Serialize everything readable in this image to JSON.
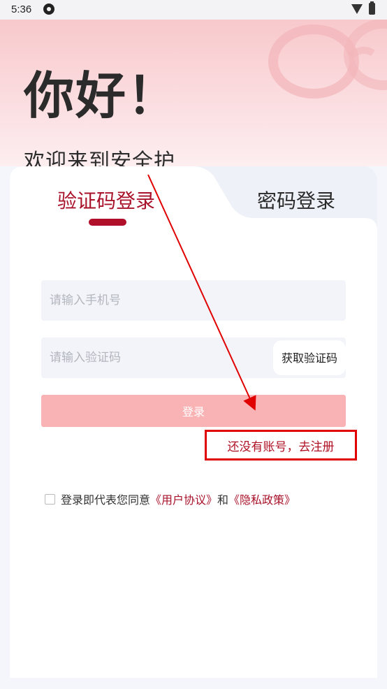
{
  "status_bar": {
    "time": "5:36",
    "icons": [
      "app-notification-icon",
      "wifi-icon",
      "battery-icon"
    ]
  },
  "hero": {
    "title": "你好！",
    "subtitle": "欢迎来到安全护"
  },
  "tabs": [
    {
      "label": "验证码登录",
      "active": true
    },
    {
      "label": "密码登录",
      "active": false
    }
  ],
  "form": {
    "phone_placeholder": "请输入手机号",
    "code_placeholder": "请输入验证码",
    "get_code_label": "获取验证码",
    "login_label": "登录",
    "register_label": "还没有账号，去注册"
  },
  "agreement": {
    "prefix": "登录即代表您同意",
    "user_agreement": "《用户协议》",
    "conjunction": "和",
    "privacy_policy": "《隐私政策》"
  },
  "colors": {
    "accent": "#a8122a",
    "login_button": "#f9b3b4",
    "hero_pink": "#f8c9cc",
    "annotation_red": "#e00000"
  }
}
